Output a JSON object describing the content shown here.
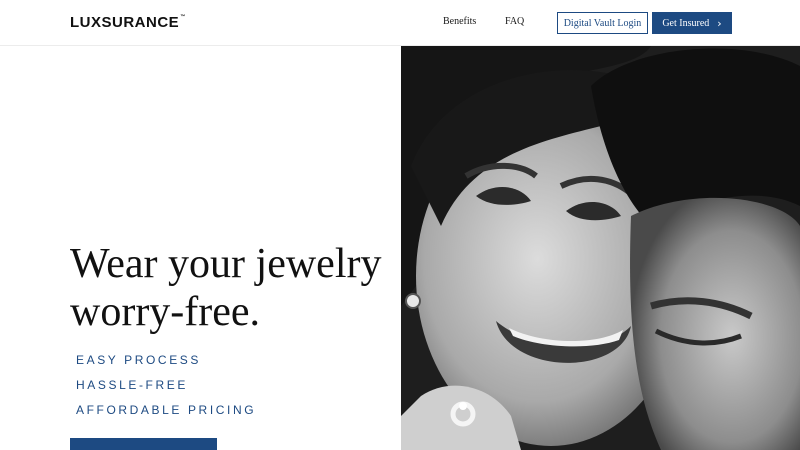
{
  "brand": {
    "logo_text": "LUXSURANCE",
    "logo_mark": "LU",
    "logo_rest": "XSURANCE",
    "trademark": "™",
    "primary_color": "#1d4a82"
  },
  "nav": {
    "benefits": "Benefits",
    "faq": "FAQ"
  },
  "buttons": {
    "vault_login": "Digital Vault Login",
    "get_insured": "Get Insured"
  },
  "hero": {
    "headline_line1": "Wear your jewelry",
    "headline_line2": "worry-free.",
    "features": [
      "EASY PROCESS",
      "HASSLE-FREE",
      "AFFORDABLE PRICING"
    ]
  },
  "icons": {
    "get_insured_arrow": "chevron-right-icon"
  }
}
